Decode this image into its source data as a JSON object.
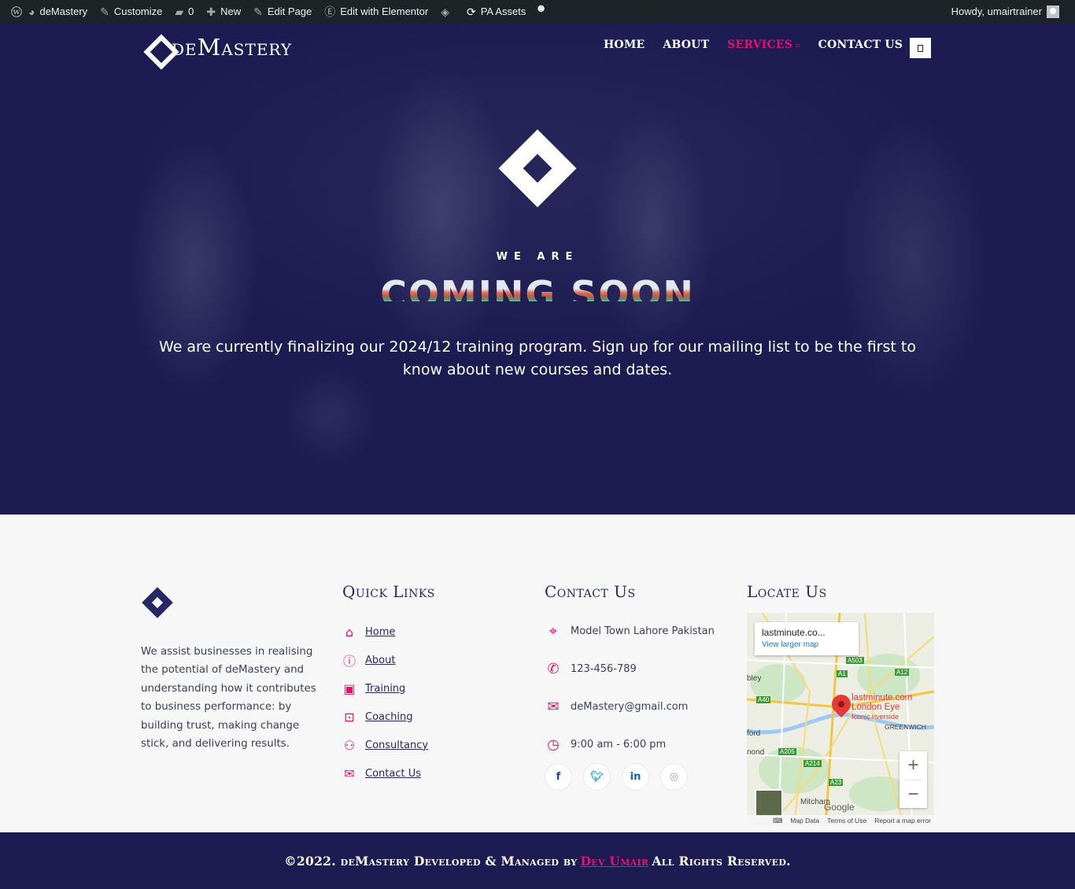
{
  "admin_bar": {
    "site_name": "deMastery",
    "customize": "Customize",
    "comments_count": "0",
    "new": "New",
    "edit_page": "Edit Page",
    "edit_elementor": "Edit with Elementor",
    "pa_assets": "PA Assets",
    "howdy": "Howdy, umairtrainer"
  },
  "header": {
    "logo_text": "deMastery",
    "menu": [
      "HOME",
      "ABOUT",
      "SERVICES",
      "CONTACT US"
    ],
    "active_item": "SERVICES"
  },
  "hero": {
    "kicker": "WE ARE",
    "animated_text": "COMING SOON",
    "description": "We are currently finalizing our 2024/12 training program. Sign up for our mailing list to be the first to know about new courses and dates."
  },
  "footer": {
    "about": "We assist businesses in realising the potential of deMastery and understanding how it contributes to business performance: by building trust, making change stick, and delivering results.",
    "quick_links": {
      "heading": "Quick Links",
      "items": [
        {
          "label": "Home",
          "icon": "home-icon"
        },
        {
          "label": "About",
          "icon": "info-icon"
        },
        {
          "label": "Training",
          "icon": "training-icon"
        },
        {
          "label": "Coaching",
          "icon": "coaching-icon"
        },
        {
          "label": "Consultancy",
          "icon": "consultancy-icon"
        },
        {
          "label": "Contact Us",
          "icon": "envelope-icon"
        }
      ]
    },
    "contact": {
      "heading": "Contact Us",
      "address": "Model Town Lahore Pakistan",
      "phone": "123-456-789",
      "email": "deMastery@gmail.com",
      "hours": "9:00 am - 6:00 pm"
    },
    "socials": [
      "facebook-icon",
      "twitter-icon",
      "linkedin-icon",
      "instagram-icon"
    ],
    "locate": {
      "heading": "Locate Us",
      "card_title": "lastminute.co...",
      "card_link": "View larger map",
      "place_name_1": "lastminute.com",
      "place_name_2": "London Eye",
      "place_sub": "Iconic riverside",
      "label_greenwich": "GREENWICH",
      "label_mitcham": "Mitcham",
      "label_bley": "bley",
      "label_ford": "ford",
      "label_nond": "nond",
      "road_a1": "A1",
      "road_a12": "A12",
      "road_a40": "A40",
      "road_a205": "A205",
      "road_a214": "A214",
      "road_a23": "A23",
      "road_a503": "A503",
      "google": "Google",
      "map_data": "Map Data",
      "terms": "Terms of Use",
      "report": "Report a map error"
    }
  },
  "bottom_bar": {
    "prefix": "©2022. deMastery Developed & Managed by",
    "author": "Dev Umair",
    "suffix": "All Rights Reserved."
  },
  "colors": {
    "navy": "#1d1c52",
    "accent": "#e4126c",
    "admin_bar": "#1d2327"
  }
}
